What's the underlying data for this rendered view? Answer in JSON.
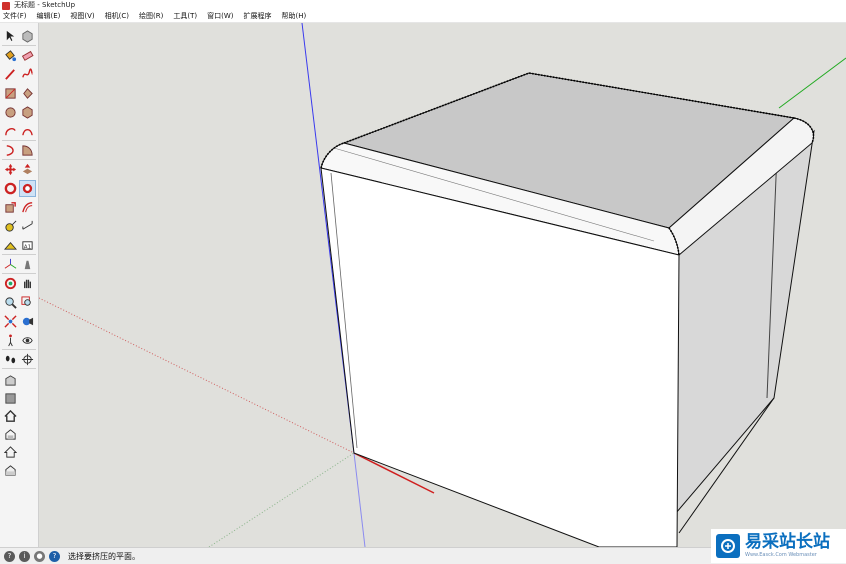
{
  "window": {
    "title": "无标题 - SketchUp"
  },
  "menu": [
    {
      "label": "文件(F)"
    },
    {
      "label": "编辑(E)"
    },
    {
      "label": "视图(V)"
    },
    {
      "label": "相机(C)"
    },
    {
      "label": "绘图(R)"
    },
    {
      "label": "工具(T)"
    },
    {
      "label": "窗口(W)"
    },
    {
      "label": "扩展程序"
    },
    {
      "label": "帮助(H)"
    }
  ],
  "toolbar": {
    "tools": [
      {
        "icon": "select-arrow-icon"
      },
      {
        "icon": "make-component-icon"
      },
      {
        "icon": "paint-bucket-icon"
      },
      {
        "icon": "eraser-icon"
      },
      {
        "icon": "line-pencil-icon"
      },
      {
        "icon": "freehand-icon"
      },
      {
        "icon": "rectangle-icon"
      },
      {
        "icon": "rotated-rectangle-icon"
      },
      {
        "icon": "circle-icon"
      },
      {
        "icon": "polygon-icon"
      },
      {
        "icon": "arc-icon"
      },
      {
        "icon": "two-point-arc-icon"
      },
      {
        "icon": "three-point-arc-icon"
      },
      {
        "icon": "pie-icon"
      },
      {
        "icon": "move-icon"
      },
      {
        "icon": "push-pull-icon"
      },
      {
        "icon": "rotate-icon"
      },
      {
        "icon": "follow-me-icon"
      },
      {
        "icon": "scale-icon"
      },
      {
        "icon": "offset-icon"
      },
      {
        "icon": "tape-measure-icon"
      },
      {
        "icon": "dimension-icon"
      },
      {
        "icon": "protractor-icon"
      },
      {
        "icon": "text-icon"
      },
      {
        "icon": "axes-icon"
      },
      {
        "icon": "3d-text-icon"
      },
      {
        "icon": "orbit-icon"
      },
      {
        "icon": "pan-icon"
      },
      {
        "icon": "zoom-icon"
      },
      {
        "icon": "zoom-window-icon"
      },
      {
        "icon": "zoom-extents-icon"
      },
      {
        "icon": "position-camera-icon"
      },
      {
        "icon": "walk-icon"
      },
      {
        "icon": "look-around-icon"
      },
      {
        "icon": "footprints-icon"
      },
      {
        "icon": "section-plane-icon"
      },
      {
        "icon": "warehouse-icon"
      },
      {
        "icon": "extension-warehouse-icon"
      },
      {
        "icon": "home-view-icon"
      },
      {
        "icon": "front-view-icon"
      },
      {
        "icon": "house-outline-icon"
      },
      {
        "icon": "house-side-icon"
      }
    ],
    "active_tool": "follow-me-icon"
  },
  "status": {
    "text": "选择要挤压的平面。",
    "icons": [
      "geo-location-icon",
      "credits-icon",
      "user-icon",
      "help-icon"
    ]
  },
  "watermark": {
    "main": "易采站长站",
    "sub": "Www.Easck.Com Webmaster"
  },
  "colors": {
    "viewport_bg": "#e0e0dc",
    "face_front": "#ffffff",
    "face_top": "#c8c8c8",
    "face_side": "#d8d8d8",
    "edge": "#111111",
    "axis_blue": "#3a3aee",
    "axis_red": "#d02020",
    "axis_green": "#22aa22",
    "brand": "#0b6fbf"
  }
}
